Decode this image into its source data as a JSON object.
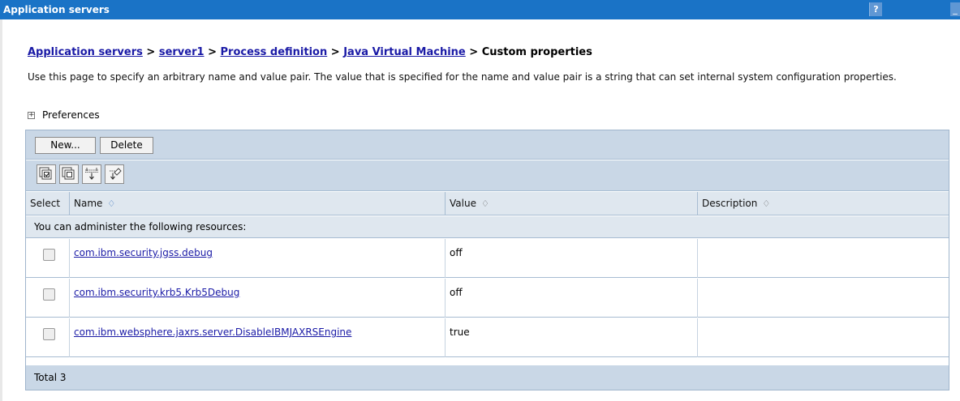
{
  "window": {
    "title": "Application servers",
    "help_glyph": "?",
    "minimize_glyph": "_"
  },
  "breadcrumb": {
    "items": [
      "Application servers",
      "server1",
      "Process definition",
      "Java Virtual Machine"
    ],
    "separator": ">",
    "current": "Custom properties"
  },
  "description": "Use this page to specify an arbitrary name and value pair. The value that is specified for the name and value pair is a string that can set internal system configuration properties.",
  "preferences": {
    "label": "Preferences",
    "expand_glyph": "+"
  },
  "toolbar": {
    "new_label": "New...",
    "delete_label": "Delete"
  },
  "icon_toolbar": [
    "select-all-icon",
    "deselect-all-icon",
    "show-filter-icon",
    "clear-filter-icon"
  ],
  "table": {
    "columns": {
      "select": "Select",
      "name": "Name",
      "value": "Value",
      "description": "Description"
    },
    "sort_glyph": "♢",
    "resources_caption": "You can administer the following resources:",
    "rows": [
      {
        "name": "com.ibm.security.jgss.debug",
        "value": "off",
        "description": ""
      },
      {
        "name": "com.ibm.security.krb5.Krb5Debug",
        "value": "off",
        "description": ""
      },
      {
        "name": "com.ibm.websphere.jaxrs.server.DisableIBMJAXRSEngine",
        "value": "true",
        "description": ""
      }
    ],
    "total": "Total 3"
  },
  "colors": {
    "title_bar": "#1a73c6",
    "toolbar": "#c9d7e6",
    "header": "#dfe7ef",
    "link": "#1a1aa6"
  }
}
